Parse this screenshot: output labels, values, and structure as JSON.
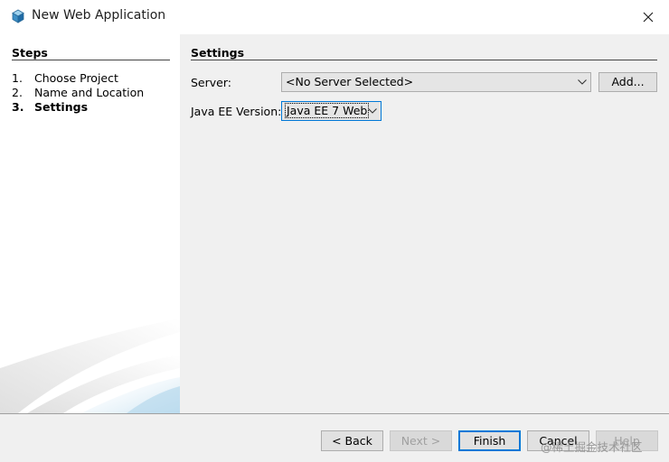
{
  "window": {
    "title": "New Web Application"
  },
  "steps": {
    "heading": "Steps",
    "items": [
      {
        "num": "1.",
        "label": "Choose Project",
        "active": false
      },
      {
        "num": "2.",
        "label": "Name and Location",
        "active": false
      },
      {
        "num": "3.",
        "label": "Settings",
        "active": true
      }
    ]
  },
  "settings": {
    "heading": "Settings",
    "server": {
      "label": "Server:",
      "value": "<No Server Selected>",
      "add_label": "Add..."
    },
    "java_ee": {
      "label": "Java EE Version:",
      "value": "Java EE 7 Web"
    }
  },
  "footer": {
    "back_label": "< Back",
    "next_label": "Next >",
    "finish_label": "Finish",
    "cancel_label": "Cancel",
    "help_label": "Help"
  },
  "watermark": "@稀土掘金技术社区",
  "colors": {
    "accent": "#0078d7",
    "panel": "#f0f0f0"
  }
}
